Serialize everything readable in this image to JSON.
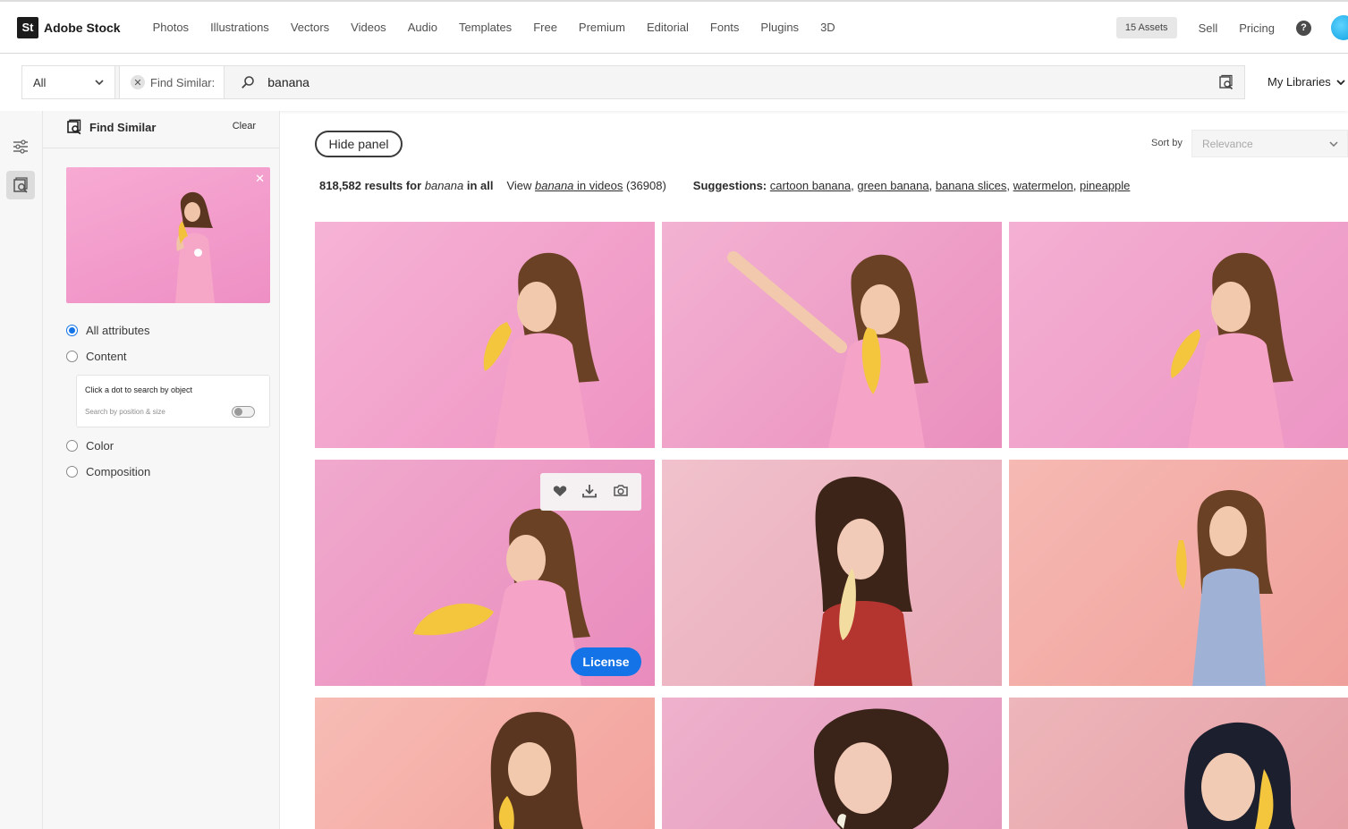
{
  "nav": {
    "logo_mark": "St",
    "logo_text": "Adobe Stock",
    "links": [
      "Photos",
      "Illustrations",
      "Vectors",
      "Videos",
      "Audio",
      "Templates",
      "Free",
      "Premium",
      "Editorial",
      "Fonts",
      "Plugins",
      "3D"
    ],
    "assets_label": "15 Assets",
    "sell_label": "Sell",
    "pricing_label": "Pricing",
    "help_glyph": "?",
    "icons": {
      "help": "help-circle-icon",
      "avatar": "user-avatar"
    }
  },
  "search": {
    "asset_type": "All",
    "chip_label": "Find Similar:",
    "query": "banana",
    "my_libraries": "My Libraries"
  },
  "panel": {
    "title": "Find Similar",
    "clear_label": "Clear",
    "options": [
      "All attributes",
      "Content",
      "Color",
      "Composition"
    ],
    "selected_option": "All attributes",
    "object_search_title": "Click a dot to search by object",
    "object_search_toggle_label": "Search by position & size",
    "object_search_toggle_on": false
  },
  "main": {
    "hide_panel_label": "Hide panel",
    "sort_label": "Sort by",
    "sort_value": "Relevance",
    "results_count": "818,582 results for",
    "results_term": "banana",
    "results_scope": "in all",
    "view_prefix": "View",
    "view_term": "banana",
    "view_link_rest": "in videos",
    "view_count": "(36908)",
    "suggestions_label": "Suggestions:",
    "suggestions": [
      "cartoon banana",
      "green banana",
      "banana slices",
      "watermelon",
      "pineapple"
    ],
    "license_label": "License"
  },
  "colors": {
    "accent": "#1473e6",
    "thumb_pink": "#ee93c3",
    "text": "#2c2c2c"
  }
}
